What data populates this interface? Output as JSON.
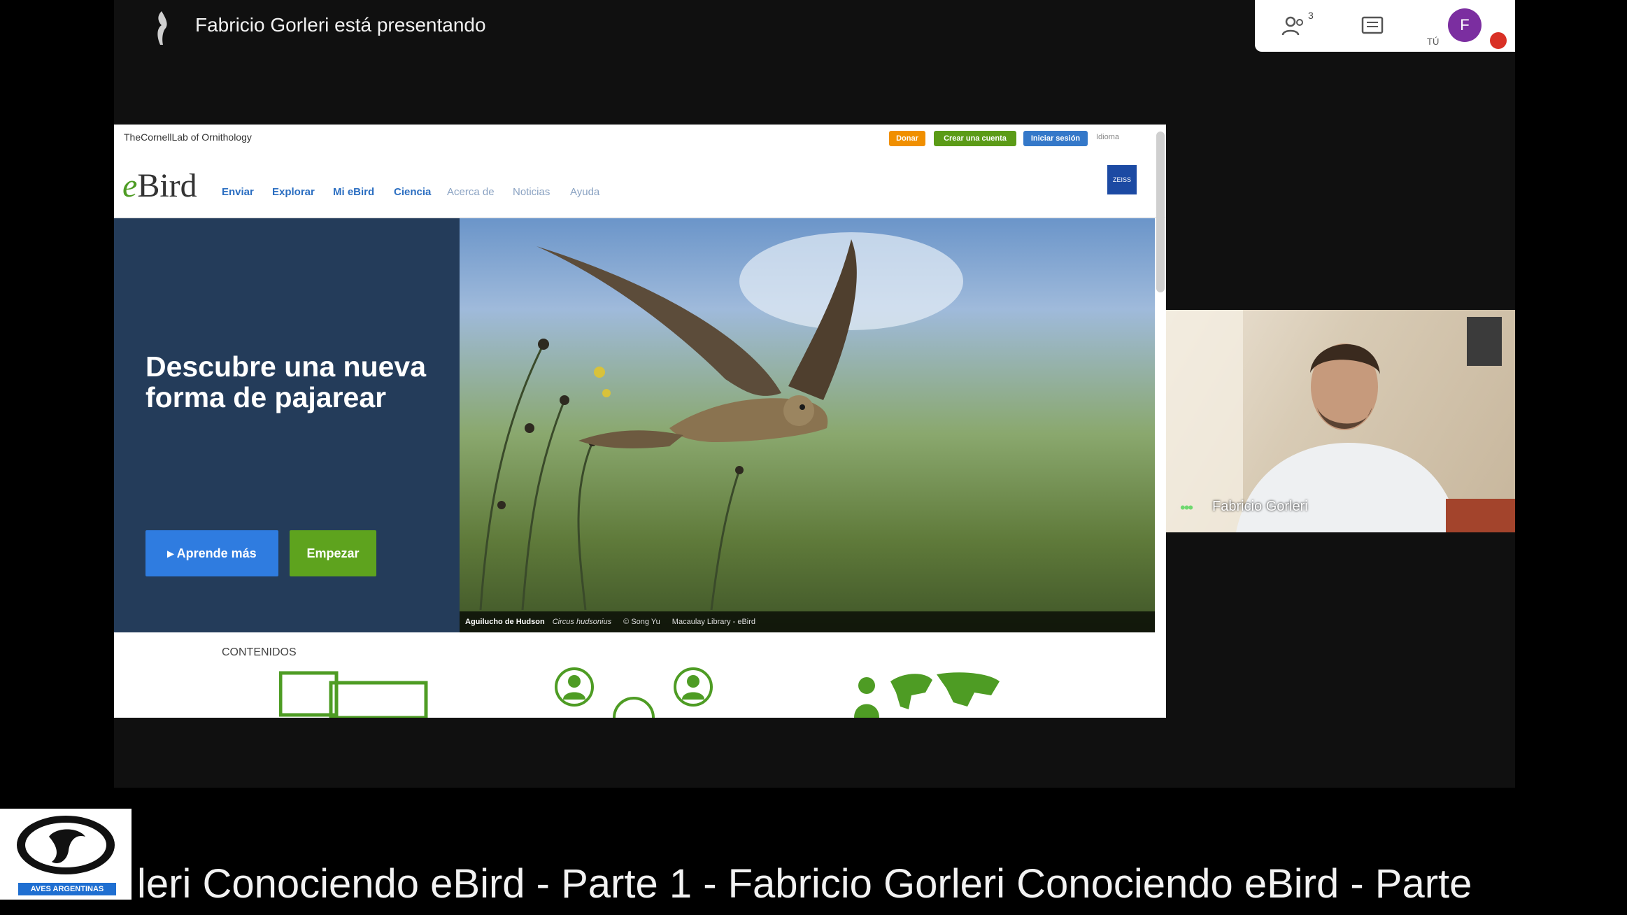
{
  "meet": {
    "presenter_text": "Fabricio Gorleri está presentando",
    "participants_count": "3",
    "you_label": "TÚ",
    "user_initial": "F"
  },
  "shared_screen": {
    "cornell_logo": "TheCornellLab of Ornithology",
    "top_buttons": {
      "donate": "Donar",
      "create_account": "Crear una cuenta",
      "sign_in": "Iniciar sesión",
      "language": "Idioma"
    },
    "logo": "eBird",
    "nav_items": [
      "Enviar",
      "Explorar",
      "Mi eBird",
      "Ciencia",
      "Acerca de",
      "Noticias",
      "Ayuda"
    ],
    "sponsor": "ZEISS",
    "hero": {
      "headline": "Descubre una nueva forma de pajarear",
      "learn_more_button": "Aprende más",
      "start_button": "Empezar"
    },
    "photo_caption": {
      "species": "Aguilucho de Hudson",
      "scientific": "Circus hudsonius",
      "credit": "© Song Yu",
      "source": "Macaulay Library - eBird"
    },
    "contents_title": "CONTENIDOS"
  },
  "camera": {
    "name": "Fabricio Gorleri"
  },
  "broadcast": {
    "ticker": "leri  Conociendo eBird - Parte 1 - Fabricio Gorleri  Conociendo eBird - Parte",
    "org_logo_label": "AVES ARGENTINAS"
  },
  "colors": {
    "ebird_green": "#4e9c24",
    "ebird_blue": "#2b6ec1",
    "hero_navy": "#243c5a"
  }
}
